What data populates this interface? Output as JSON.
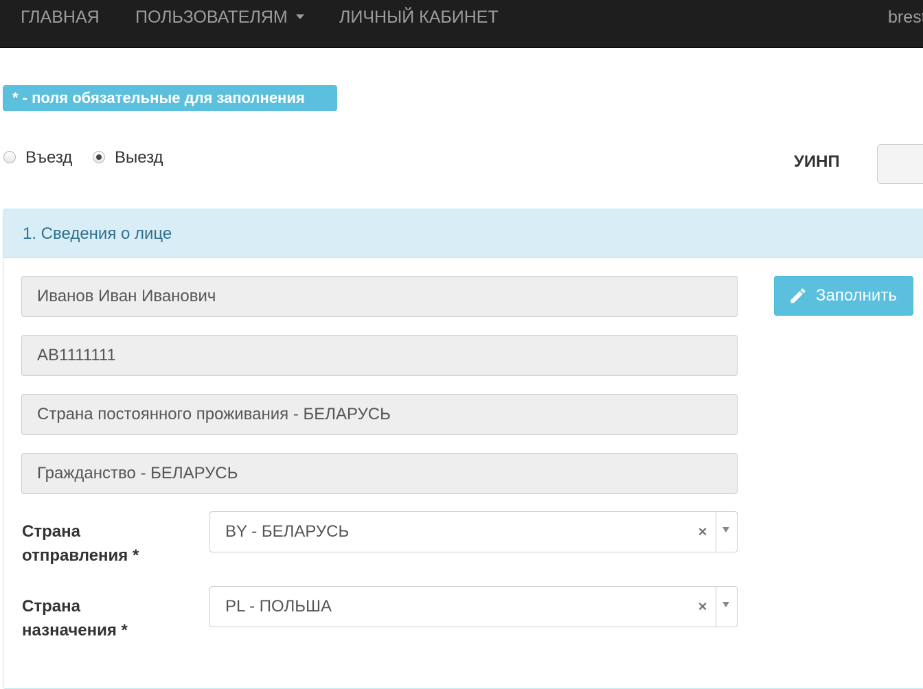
{
  "navbar": {
    "home": "ГЛАВНАЯ",
    "users": "ПОЛЬЗОВАТЕЛЯМ",
    "cabinet": "ЛИЧНЫЙ КАБИНЕТ",
    "user": "brest"
  },
  "notice": "* - поля обязательные для заполнения",
  "direction": {
    "options": [
      "Въезд",
      "Выезд"
    ],
    "selected": "Выезд"
  },
  "uinp": {
    "label": "УИНП",
    "value": ""
  },
  "panel": {
    "title": "1. Сведения о лице",
    "fields": [
      "Иванов Иван Иванович",
      "AB1111111",
      "Страна постоянного проживания - БЕЛАРУСЬ",
      "Гражданство - БЕЛАРУСЬ"
    ],
    "fill_button": "Заполнить",
    "departure": {
      "label_line1": "Страна",
      "label_line2": "отправления *",
      "value": "BY - БЕЛАРУСЬ"
    },
    "destination": {
      "label_line1": "Страна",
      "label_line2": "назначения *",
      "value": "PL - ПОЛЬША"
    },
    "clear_symbol": "×"
  },
  "colors": {
    "navbar_bg": "#1e1e1e",
    "nav_text": "#9d9d9d",
    "info": "#5bc0de",
    "panel_heading_bg": "#d9edf7",
    "panel_title": "#31708f"
  }
}
